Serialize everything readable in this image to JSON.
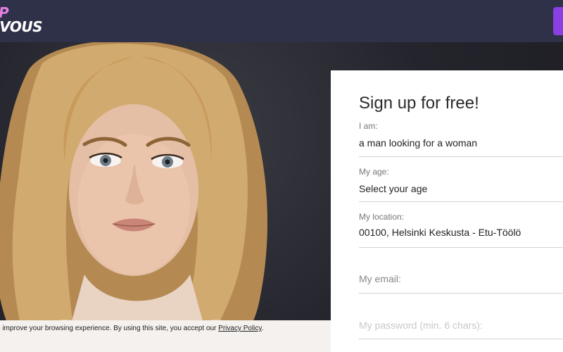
{
  "header": {
    "logo_line1": "P",
    "logo_line2": "DEZVOUS"
  },
  "hero": {
    "image": "portrait-photo"
  },
  "cookie": {
    "text": "o improve your browsing experience. By using this site, you accept our ",
    "link": "Privacy Policy",
    "end": "."
  },
  "signup": {
    "title": "Sign up for free!",
    "iam_label": "I am:",
    "iam_value": "a man looking for a woman",
    "age_label": "My age:",
    "age_value": "Select your age",
    "location_label": "My location:",
    "location_value": "00100, Helsinki Keskusta - Etu-Töölö",
    "email_placeholder": "My email:",
    "password_placeholder": "My password (min. 6 chars):"
  },
  "colors": {
    "header_bg": "#2f3149",
    "accent_purple": "#8a3fe0",
    "logo_pink": "#e27fe0"
  }
}
